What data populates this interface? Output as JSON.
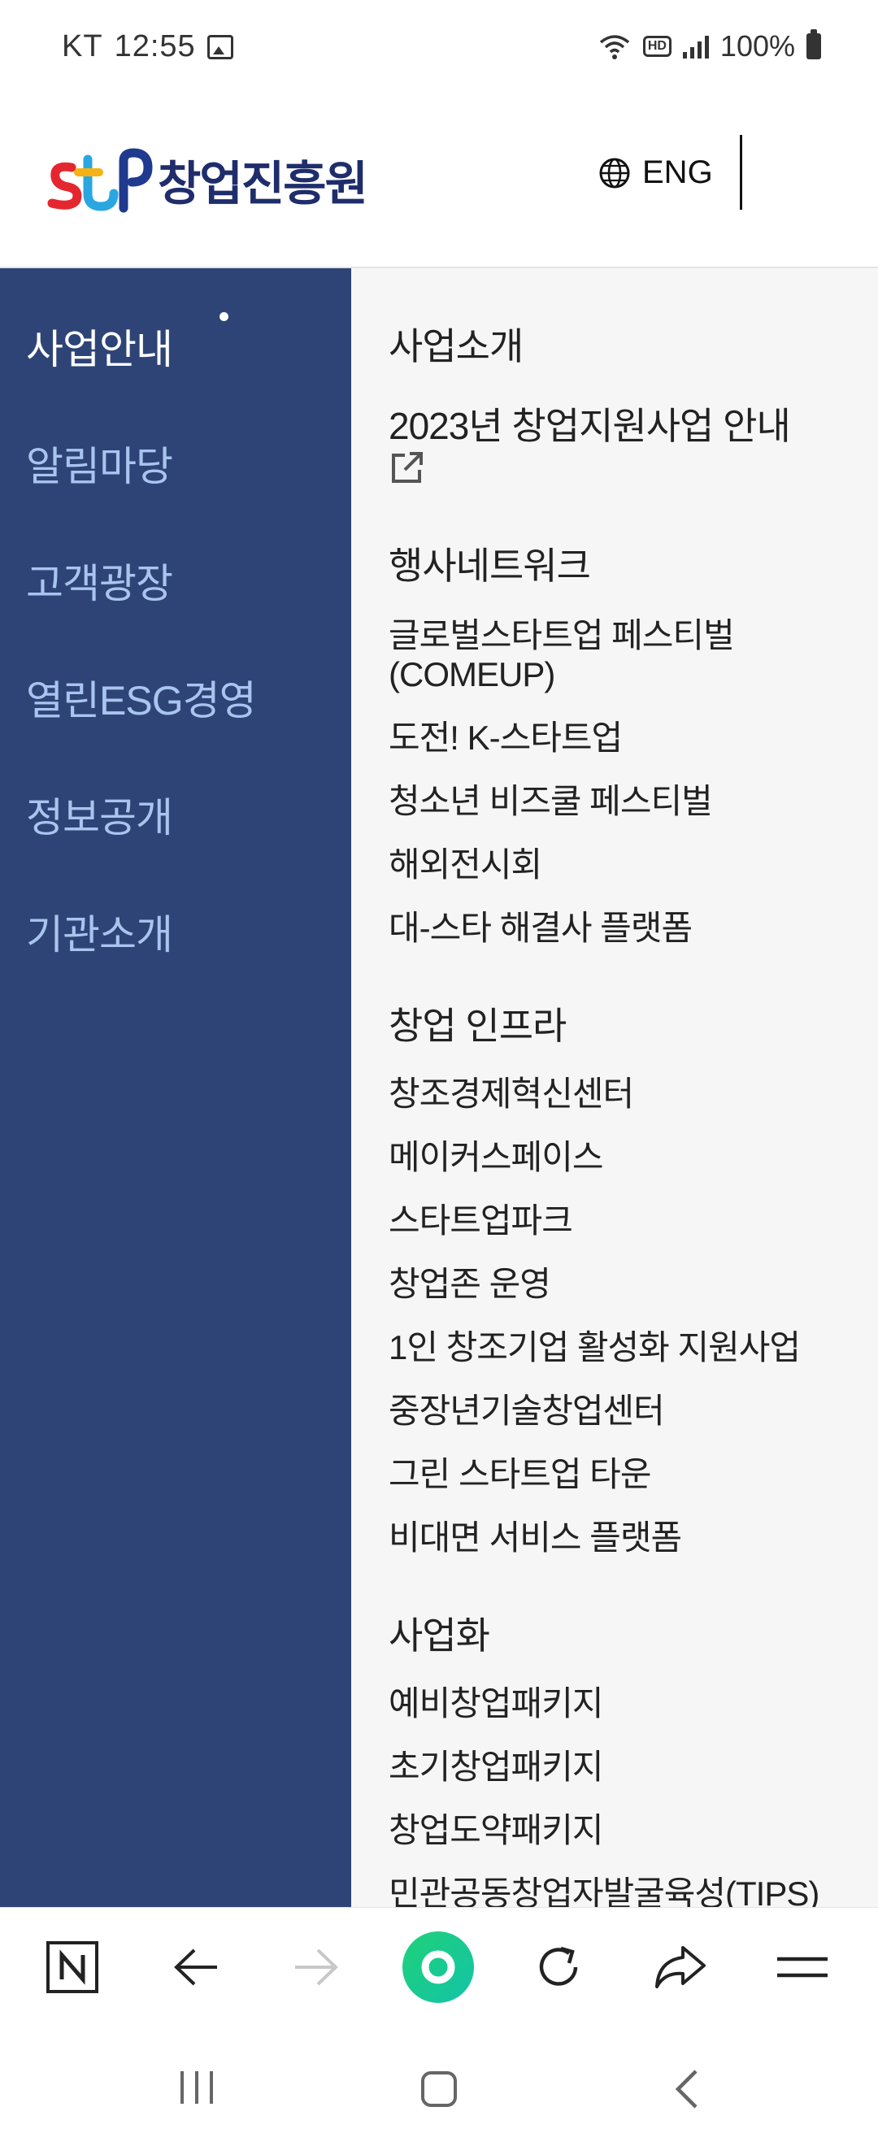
{
  "status_bar": {
    "carrier": "KT",
    "time": "12:55",
    "hd_label": "HD",
    "battery": "100%"
  },
  "header": {
    "logo_text": "창업진흥원",
    "lang_label": "ENG"
  },
  "left_nav": {
    "items": [
      {
        "label": "사업안내"
      },
      {
        "label": "알림마당"
      },
      {
        "label": "고객광장"
      },
      {
        "label": "열린ESG경영"
      },
      {
        "label": "정보공개"
      },
      {
        "label": "기관소개"
      }
    ]
  },
  "right_panel": {
    "items": [
      {
        "label": "사업소개"
      },
      {
        "label": "2023년 창업지원사업 안내"
      },
      {
        "label": "행사네트워크"
      },
      {
        "label": "글로벌스타트업 페스티벌 (COMEUP)"
      },
      {
        "label": "도전! K-스타트업"
      },
      {
        "label": "청소년 비즈쿨 페스티벌"
      },
      {
        "label": "해외전시회"
      },
      {
        "label": "대-스타 해결사 플랫폼"
      },
      {
        "label": "창업 인프라"
      },
      {
        "label": "창조경제혁신센터"
      },
      {
        "label": "메이커스페이스"
      },
      {
        "label": "스타트업파크"
      },
      {
        "label": "창업존 운영"
      },
      {
        "label": "1인 창조기업 활성화 지원사업"
      },
      {
        "label": "중장년기술창업센터"
      },
      {
        "label": "그린 스타트업 타운"
      },
      {
        "label": "비대면 서비스 플랫폼"
      },
      {
        "label": "사업화"
      },
      {
        "label": "예비창업패키지"
      },
      {
        "label": "초기창업패키지"
      },
      {
        "label": "창업도약패키지"
      },
      {
        "label": "민관공동창업자발굴육성(TIPS)"
      }
    ]
  },
  "colors": {
    "nav_bg": "#2e4476",
    "nav_text": "#a9c4ef",
    "nav_active": "#ffffff",
    "panel_bg": "#f6f6f6",
    "accent_green": "#19c98a"
  }
}
